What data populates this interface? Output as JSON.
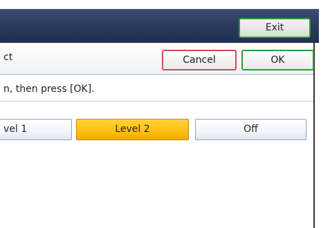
{
  "header": {
    "exit_label": "Exit"
  },
  "dialog": {
    "title_fragment": "ct",
    "cancel_label": "Cancel",
    "ok_label": "OK",
    "instruction_fragment": "n, then press [OK]."
  },
  "options": [
    {
      "label": "vel 1",
      "selected": false
    },
    {
      "label": "Level 2",
      "selected": true
    },
    {
      "label": "Off",
      "selected": false
    }
  ],
  "colors": {
    "topbar": "#2b3c5e",
    "exit_border": "#2f9a3a",
    "cancel_border": "#d04a5a",
    "ok_border": "#2f9a3a",
    "selected_fill": "#ffbf10",
    "option_border": "#8ea2c4"
  }
}
